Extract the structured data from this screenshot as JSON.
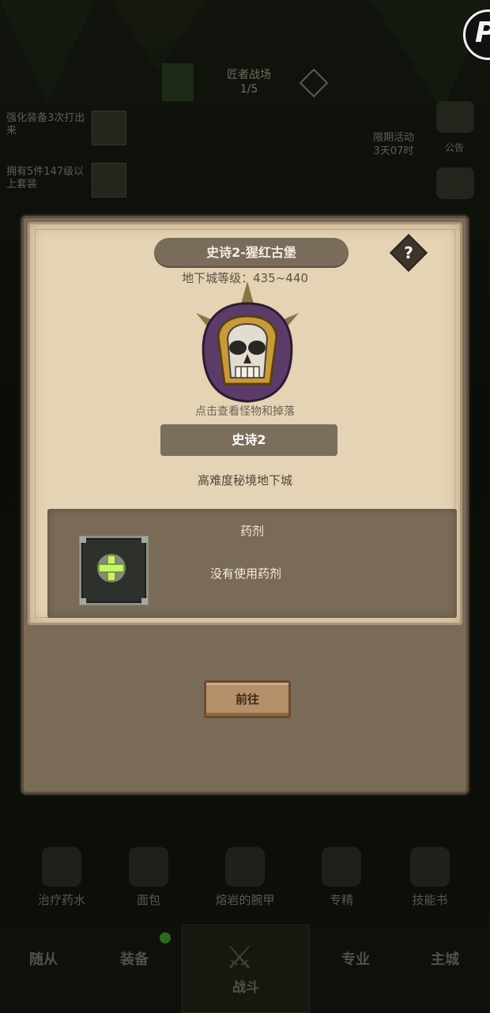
{
  "background": {
    "stage_title": "匠者战场",
    "stage_progress": "1/5",
    "quest_1": "强化装备3次打出来",
    "quest_2": "拥有5件147级以上套装",
    "timer_label": "限期活动",
    "timer_value": "3天07时",
    "right_icon_label": "公告"
  },
  "corner_button": {
    "label": "P"
  },
  "dialog": {
    "title": "史诗2-猩红古堡",
    "help_label": "?",
    "level_text": "地下城等级：435~440",
    "boss_hint": "点击查看怪物和掉落",
    "difficulty_label": "史诗2",
    "description": "高难度秘境地下城",
    "potion": {
      "title": "药剂",
      "empty_text": "没有使用药剂"
    },
    "go_button": "前往"
  },
  "bottom_items": [
    "治疗药水",
    "面包",
    "熔岩的腕甲",
    "专精",
    "技能书"
  ],
  "bottom_nav": {
    "items": [
      "随从",
      "装备",
      "战斗",
      "专业",
      "主城"
    ]
  }
}
